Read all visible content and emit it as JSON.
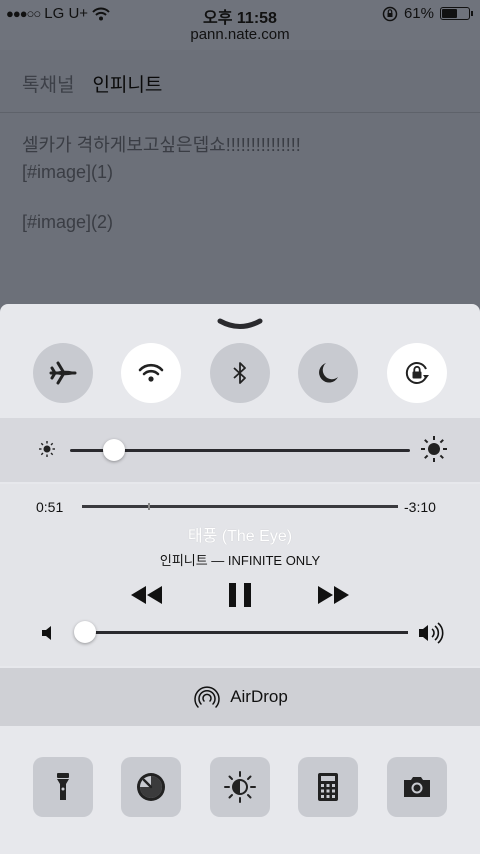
{
  "status_bar": {
    "signal_dots": "●●●○○",
    "carrier": "LG U+",
    "time": "오후 11:58",
    "battery_percent": "61%",
    "battery_level": 0.61
  },
  "browser": {
    "url": "pann.nate.com"
  },
  "page": {
    "tabs": [
      {
        "label": "톡채널",
        "active": false
      },
      {
        "label": "인피니트",
        "active": true
      }
    ],
    "post_lines": [
      "셀카가 격하게보고싶은뎁쇼!!!!!!!!!!!!!!!",
      "[#image](1)",
      "[#image](2)"
    ]
  },
  "control_center": {
    "toggles": [
      {
        "name": "airplane-mode",
        "icon": "airplane-icon",
        "on": false
      },
      {
        "name": "wifi",
        "icon": "wifi-icon",
        "on": true
      },
      {
        "name": "bluetooth",
        "icon": "bluetooth-icon",
        "on": false
      },
      {
        "name": "do-not-disturb",
        "icon": "moon-icon",
        "on": false
      },
      {
        "name": "rotation-lock",
        "icon": "rotation-lock-icon",
        "on": true
      }
    ],
    "brightness_level": 0.1,
    "media": {
      "elapsed": "0:51",
      "remaining": "-3:10",
      "progress": 0.21,
      "song_title": "태풍 (The Eye)",
      "artist_album": "인피니트 — INFINITE ONLY",
      "volume_level": 0.02
    },
    "airdrop_label": "AirDrop",
    "quick_actions": [
      "flashlight-icon",
      "timer-icon",
      "night-shift-icon",
      "calculator-icon",
      "camera-icon"
    ]
  },
  "colors": {
    "toggle_on": "#ffffff",
    "toggle_off": "#c8cad0",
    "panel": "#e7e8ec"
  }
}
